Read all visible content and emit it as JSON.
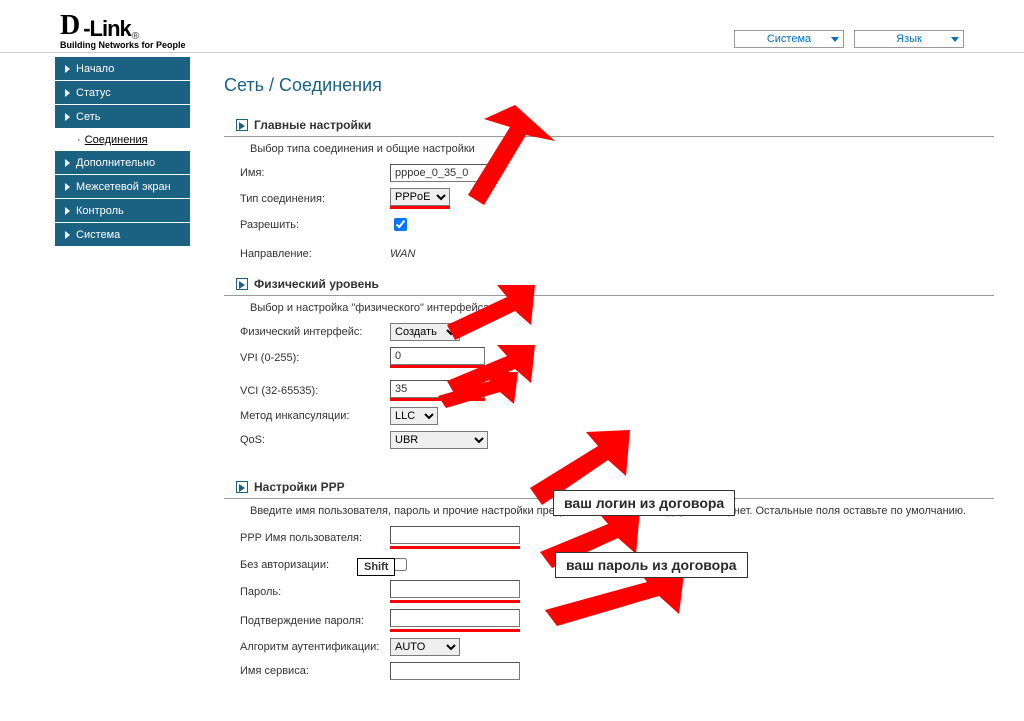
{
  "header": {
    "logo_brand": "D-Link",
    "logo_tagline": "Building Networks for People",
    "system_label": "Система",
    "lang_label": "Язык"
  },
  "sidebar": {
    "items": [
      {
        "label": "Начало"
      },
      {
        "label": "Статус"
      },
      {
        "label": "Сеть"
      },
      {
        "label": "Дополнительно"
      },
      {
        "label": "Межсетевой экран"
      },
      {
        "label": "Контроль"
      },
      {
        "label": "Система"
      }
    ],
    "sub": {
      "label": "Соединения"
    }
  },
  "title": "Сеть / Соединения",
  "main": {
    "section_title": "Главные настройки",
    "section_desc": "Выбор типа соединения и общие настройки",
    "name_label": "Имя:",
    "name_value": "pppoe_0_35_0",
    "type_label": "Тип соединения:",
    "type_value": "PPPoE",
    "allow_label": "Разрешить:",
    "direction_label": "Направление:",
    "direction_value": "WAN"
  },
  "phys": {
    "section_title": "Физический уровень",
    "section_desc": "Выбор и настройка \"физического\" интерфейса",
    "iface_label": "Физический интерфейс:",
    "iface_value": "Создать",
    "vpi_label": "VPI (0-255):",
    "vpi_value": "0",
    "vci_label": "VCI (32-65535):",
    "vci_value": "35",
    "encap_label": "Метод инкапсуляции:",
    "encap_value": "LLC",
    "qos_label": "QoS:",
    "qos_value": "UBR"
  },
  "ppp": {
    "section_title": "Настройки PPP",
    "section_desc": "Введите имя пользователя, пароль и прочие настройки предоставленные провайдером Интернет. Остальные поля оставьте по умолчанию.",
    "user_label": "PPP Имя пользователя:",
    "noauth_label": "Без авторизации:",
    "pass_label": "Пароль:",
    "confirm_label": "Подтверждение пароля:",
    "auth_label": "Алгоритм аутентификации:",
    "auth_value": "AUTO",
    "service_label": "Имя сервиса:"
  },
  "notes": {
    "login": "ваш логин из договора",
    "password": "ваш пароль из договора",
    "shift": "Shift"
  }
}
